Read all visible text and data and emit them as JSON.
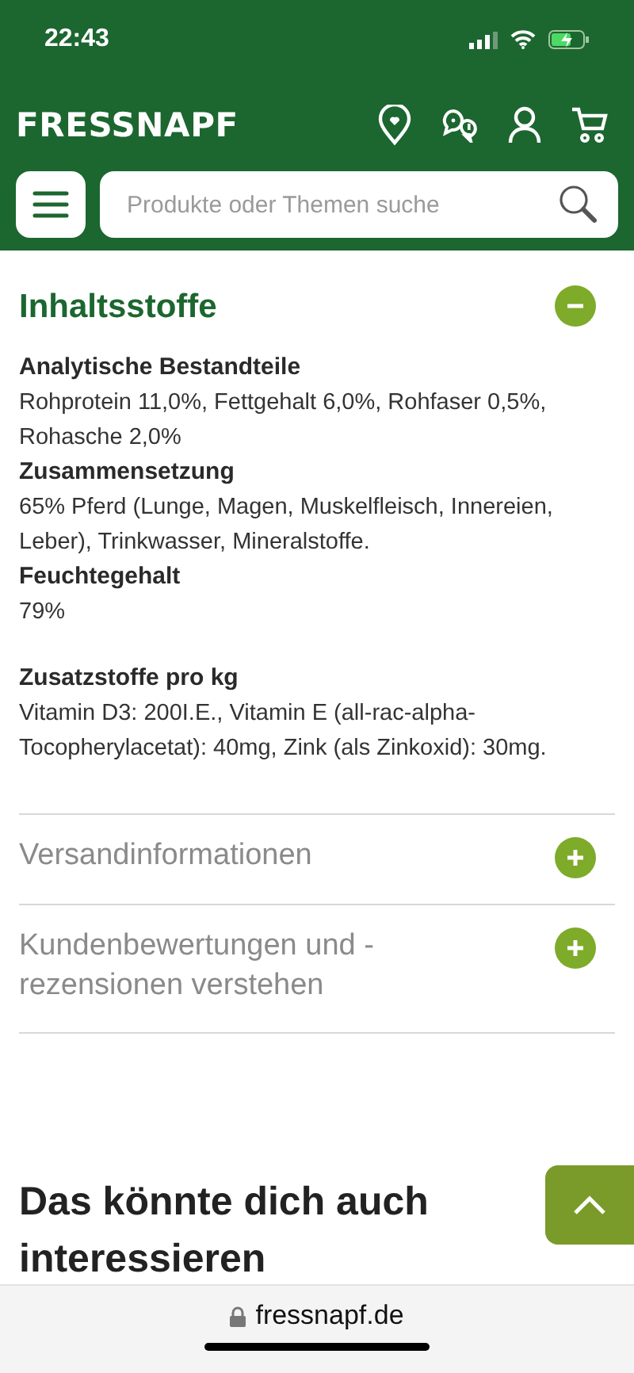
{
  "status_bar": {
    "time": "22:43"
  },
  "header": {
    "logo": "FRESSNAPF",
    "search": {
      "placeholder": "Produkte oder Themen suche"
    }
  },
  "sections": [
    {
      "title": "Inhaltsstoffe",
      "expanded": true,
      "blocks": [
        [
          {
            "heading": "Analytische Bestandteile",
            "text": "Rohprotein 11,0%, Fettgehalt 6,0%, Rohfaser 0,5%, Rohasche 2,0%"
          },
          {
            "heading": "Zusammensetzung",
            "text": "65% Pferd (Lunge, Magen, Muskelfleisch, Innereien, Leber), Trinkwasser, Mineralstoffe."
          },
          {
            "heading": "Feuchtegehalt",
            "text": "79%"
          }
        ],
        [
          {
            "heading": "Zusatzstoffe pro kg",
            "text": "Vitamin D3: 200I.E., Vitamin E (all-rac-alpha-Tocopherylacetat): 40mg, Zink (als Zinkoxid): 30mg."
          }
        ]
      ]
    },
    {
      "title": "Versandinformationen",
      "expanded": false
    },
    {
      "title": "Kundenbewertungen und -rezensionen verstehen",
      "expanded": false
    }
  ],
  "recommendations": {
    "title": "Das könnte dich auch interessieren"
  },
  "browser_bar": {
    "url": "fressnapf.de"
  }
}
